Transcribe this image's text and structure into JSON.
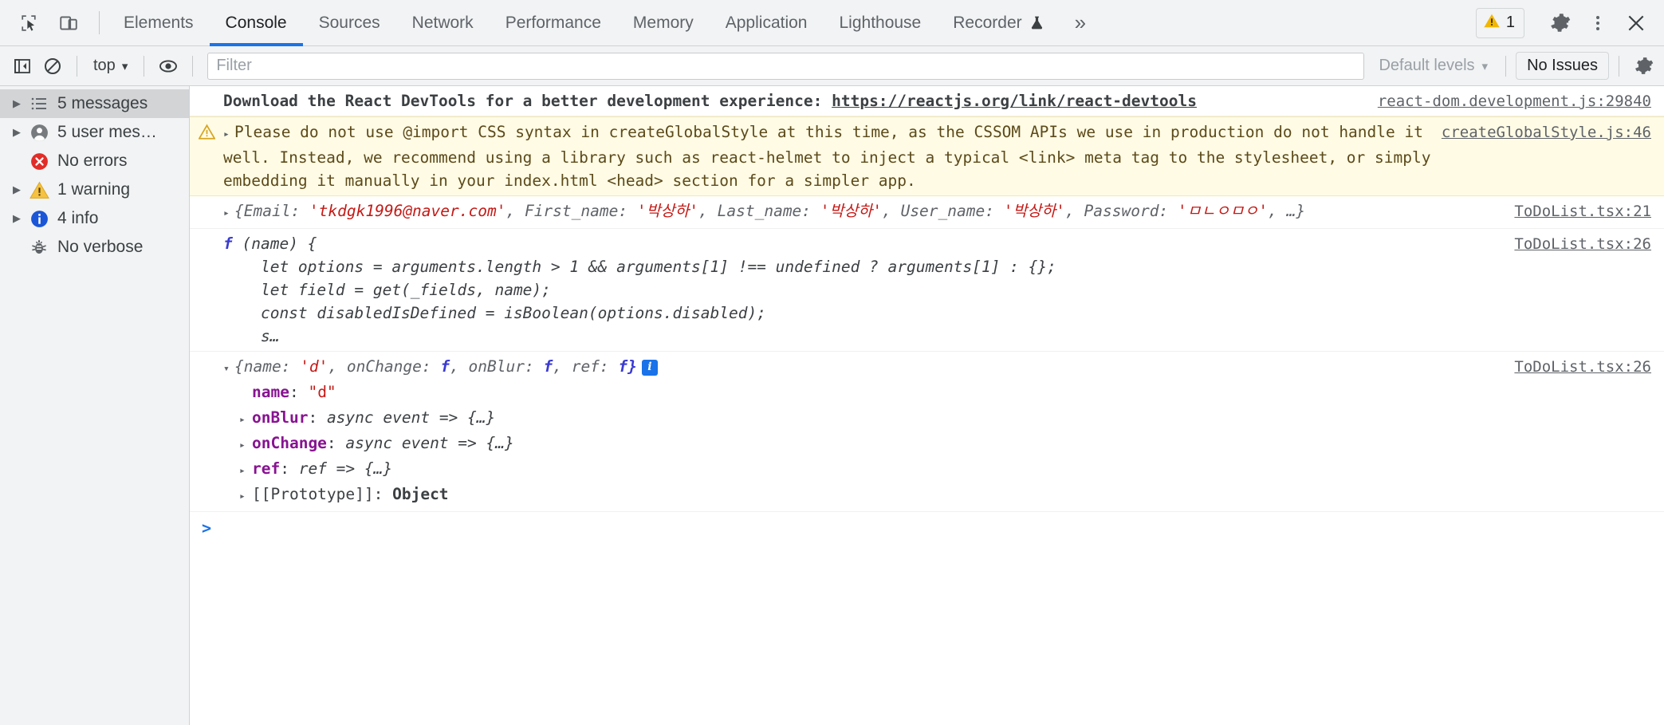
{
  "tabbar": {
    "inspect_icon": "inspect-cursor-icon",
    "device_icon": "device-toggle-icon",
    "tabs": [
      {
        "label": "Elements",
        "active": false
      },
      {
        "label": "Console",
        "active": true
      },
      {
        "label": "Sources",
        "active": false
      },
      {
        "label": "Network",
        "active": false
      },
      {
        "label": "Performance",
        "active": false
      },
      {
        "label": "Memory",
        "active": false
      },
      {
        "label": "Application",
        "active": false
      },
      {
        "label": "Lighthouse",
        "active": false
      },
      {
        "label": "Recorder",
        "active": false,
        "icon": "flask-icon"
      }
    ],
    "more_tabs": "»",
    "warning_count": "1",
    "settings_icon": "gear-icon",
    "more_icon": "kebab-menu-icon",
    "close_icon": "close-icon"
  },
  "filterbar": {
    "sidebar_toggle_icon": "show-console-sidebar-icon",
    "clear_icon": "clear-console-icon",
    "context": "top",
    "context_caret": "▾",
    "eye_icon": "live-expression-icon",
    "filter_placeholder": "Filter",
    "filter_value": "",
    "levels_label": "Default levels",
    "levels_caret": "▾",
    "issues_label": "No Issues",
    "settings_icon": "gear-icon"
  },
  "sidebar": {
    "items": [
      {
        "label": "5 messages",
        "icon": "list-icon",
        "expandable": true,
        "selected": true
      },
      {
        "label": "5 user mes…",
        "icon": "user-icon",
        "expandable": true,
        "selected": false
      },
      {
        "label": "No errors",
        "icon": "error-icon",
        "expandable": false,
        "selected": false
      },
      {
        "label": "1 warning",
        "icon": "warning-icon",
        "expandable": true,
        "selected": false
      },
      {
        "label": "4 info",
        "icon": "info-icon",
        "expandable": true,
        "selected": false
      },
      {
        "label": "No verbose",
        "icon": "bug-icon",
        "expandable": false,
        "selected": false
      }
    ]
  },
  "console": {
    "messages": [
      {
        "kind": "info-bold",
        "text_before_link": "Download the React DevTools for a better development experience: ",
        "link": "https://reactjs.org/link/react-devtools",
        "source": "react-dom.development.js:29840"
      },
      {
        "kind": "warning",
        "icon": "warning-icon",
        "disclosure": "▸",
        "text": "Please do not use @import CSS syntax in createGlobalStyle at this time, as the CSSOM APIs we use in production do not handle it well. Instead, we recommend using a library such as react-helmet to inject a typical <link> meta tag to the stylesheet, or simply embedding it manually in your index.html <head> section for a simpler app.",
        "source": "createGlobalStyle.js:46"
      },
      {
        "kind": "object-preview",
        "disclosure": "▸",
        "parts": [
          {
            "t": "{Email: ",
            "c": "key"
          },
          {
            "t": "'tkdgk1996@naver.com'",
            "c": "str"
          },
          {
            "t": ", First_name: ",
            "c": "key"
          },
          {
            "t": "'박상하'",
            "c": "str"
          },
          {
            "t": ", Last_name: ",
            "c": "key"
          },
          {
            "t": "'박상하'",
            "c": "str"
          },
          {
            "t": ", User_name: ",
            "c": "key"
          },
          {
            "t": "'박상하'",
            "c": "str"
          },
          {
            "t": ", Password: ",
            "c": "key"
          },
          {
            "t": "'ㅁㄴㅇㅁㅇ'",
            "c": "str"
          },
          {
            "t": ", …}",
            "c": "key"
          }
        ],
        "source": "ToDoList.tsx:21"
      },
      {
        "kind": "function",
        "signature_kw": "f",
        "signature_rest": " (name) {",
        "lines": [
          "    let options = arguments.length > 1 && arguments[1] !== undefined ? arguments[1] : {};",
          "    let field = get(_fields, name);",
          "    const disabledIsDefined = isBoolean(options.disabled);",
          "    s…"
        ],
        "source": "ToDoList.tsx:26"
      },
      {
        "kind": "object-expanded",
        "disclosure": "▾",
        "header_parts": [
          {
            "t": "{name: ",
            "c": "key"
          },
          {
            "t": "'d'",
            "c": "str"
          },
          {
            "t": ", onChange: ",
            "c": "key"
          },
          {
            "t": "f",
            "c": "fnkw"
          },
          {
            "t": ", onBlur: ",
            "c": "key"
          },
          {
            "t": "f",
            "c": "fnkw"
          },
          {
            "t": ", ref: ",
            "c": "key"
          },
          {
            "t": "f}",
            "c": "fnkw"
          }
        ],
        "badge": "i",
        "children": [
          {
            "arrow": "",
            "key": "name",
            "sep": ": ",
            "value": "\"d\"",
            "vclass": "str"
          },
          {
            "arrow": "▸",
            "key": "onBlur",
            "sep": ": ",
            "value": "async event => {…}",
            "vclass": "fn"
          },
          {
            "arrow": "▸",
            "key": "onChange",
            "sep": ": ",
            "value": "async event => {…}",
            "vclass": "fn"
          },
          {
            "arrow": "▸",
            "key": "ref",
            "sep": ": ",
            "value": "ref => {…}",
            "vclass": "fn"
          },
          {
            "arrow": "▸",
            "key": "[[Prototype]]",
            "sep": ": ",
            "value": "Object",
            "vclass": "proto"
          }
        ],
        "source": "ToDoList.tsx:26"
      }
    ],
    "prompt_caret": ">",
    "prompt_value": ""
  },
  "colors": {
    "accent": "#1a73e8",
    "warning_bg": "#fffbe5",
    "warning_text": "#5c4a1a",
    "error_red": "#d93025",
    "string_red": "#c41a16",
    "key_purple": "#881391",
    "chrome_gray": "#f1f3f4"
  }
}
